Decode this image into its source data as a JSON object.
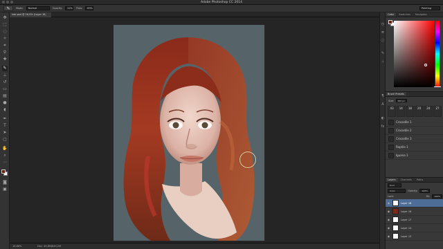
{
  "app": {
    "title": "Adobe Photoshop CC 2014"
  },
  "options": {
    "mode_label": "Mode:",
    "mode_value": "Normal",
    "opacity_label": "Opacity:",
    "opacity_value": "12%",
    "flow_label": "Flow:",
    "flow_value": "83%",
    "workspace": "Painting"
  },
  "document": {
    "tab_label": "hair.psd @ 16,9% (Layer 16, RGB/8)"
  },
  "status": {
    "zoom": "16.88%",
    "doc_size": "Doc: 49,8M/849,2M"
  },
  "panels": {
    "color_tabs": [
      "Color",
      "Swatches",
      "Navigator"
    ],
    "foreground_color": "#6d1d10",
    "background_color": "#ffffff",
    "brush_presets": {
      "title": "Brush Presets",
      "size_label": "Size:",
      "size_value": "482 px",
      "grid": [
        "43",
        "14",
        "18",
        "20",
        "24",
        "27"
      ],
      "brushes": [
        "Crocodile 1",
        "Crocodile 2",
        "Crocodile 3",
        "Reptile 1",
        "Iguana 1"
      ]
    },
    "layers": {
      "tabs": [
        "Layers",
        "Channels",
        "Paths"
      ],
      "kind_label": "Kind",
      "blend_mode": "Color",
      "opacity_label": "Opacity:",
      "opacity_value": "100%",
      "lock_label": "Lock:",
      "fill_label": "Fill:",
      "fill_value": "100%",
      "items": [
        "Layer 18",
        "Layer 16",
        "Layer 17",
        "Layer 14",
        "Layer 13"
      ]
    }
  }
}
